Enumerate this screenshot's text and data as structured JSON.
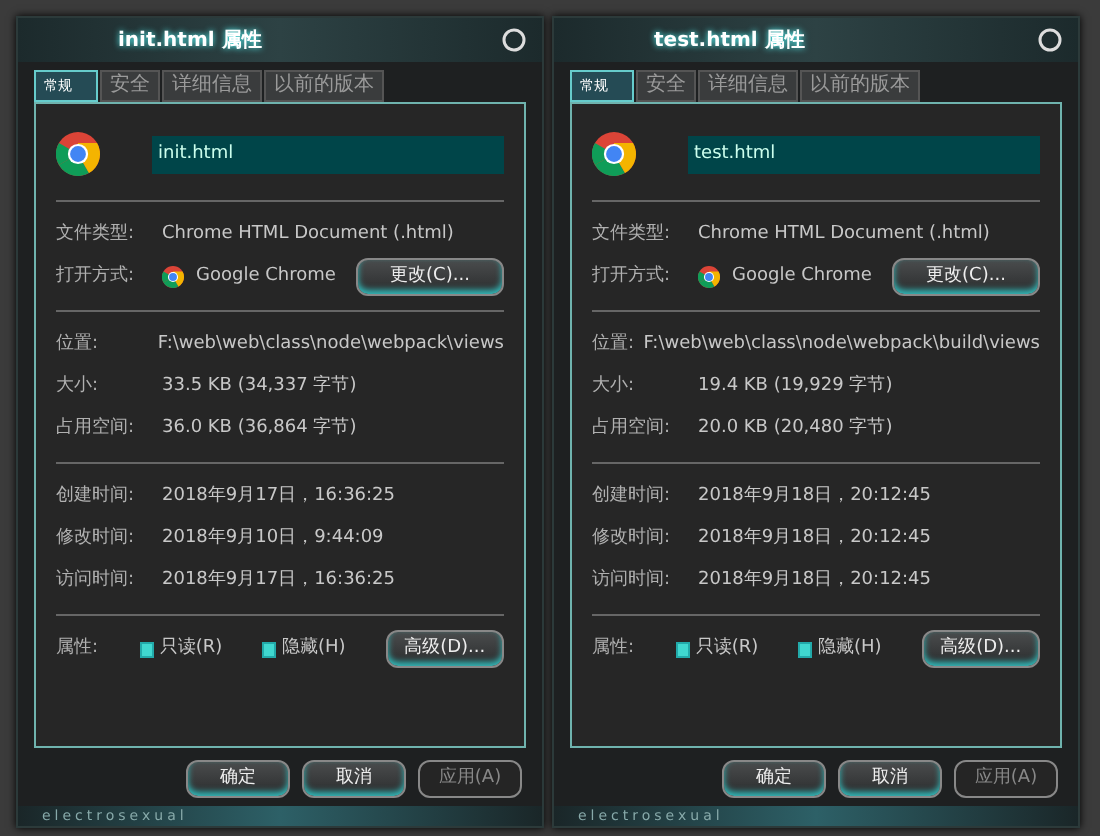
{
  "windows": [
    {
      "title": "init.html 属性",
      "tabs": [
        {
          "label": "常规",
          "selected": true
        },
        {
          "label": "安全",
          "selected": false
        },
        {
          "label": "详细信息",
          "selected": false
        },
        {
          "label": "以前的版本",
          "selected": false
        }
      ],
      "file_name": "init.html",
      "sections": [
        [
          {
            "kind": "text",
            "label": "文件类型:",
            "value": "Chrome HTML Document (.html)"
          },
          {
            "kind": "app",
            "label": "打开方式:",
            "value": "Google Chrome",
            "button": "更改(C)..."
          }
        ],
        [
          {
            "kind": "text",
            "label": "位置:",
            "value": "F:\\web\\web\\class\\node\\webpack\\views"
          },
          {
            "kind": "text",
            "label": "大小:",
            "value": "33.5 KB (34,337 字节)"
          },
          {
            "kind": "text",
            "label": "占用空间:",
            "value": "36.0 KB (36,864 字节)"
          }
        ],
        [
          {
            "kind": "text",
            "label": "创建时间:",
            "value": "2018年9月17日，16:36:25"
          },
          {
            "kind": "text",
            "label": "修改时间:",
            "value": "2018年9月10日，9:44:09"
          },
          {
            "kind": "text",
            "label": "访问时间:",
            "value": "2018年9月17日，16:36:25"
          }
        ]
      ],
      "attributes": {
        "label": "属性:",
        "checkboxes": [
          {
            "label": "只读(R)",
            "checked": true
          },
          {
            "label": "隐藏(H)",
            "checked": true
          }
        ],
        "button": "高级(D)..."
      },
      "buttons": [
        {
          "label": "确定",
          "disabled": false
        },
        {
          "label": "取消",
          "disabled": false
        },
        {
          "label": "应用(A)",
          "disabled": true
        }
      ],
      "theme_label": "electrosexual"
    },
    {
      "title": "test.html 属性",
      "tabs": [
        {
          "label": "常规",
          "selected": true
        },
        {
          "label": "安全",
          "selected": false
        },
        {
          "label": "详细信息",
          "selected": false
        },
        {
          "label": "以前的版本",
          "selected": false
        }
      ],
      "file_name": "test.html",
      "sections": [
        [
          {
            "kind": "text",
            "label": "文件类型:",
            "value": "Chrome HTML Document (.html)"
          },
          {
            "kind": "app",
            "label": "打开方式:",
            "value": "Google Chrome",
            "button": "更改(C)..."
          }
        ],
        [
          {
            "kind": "text",
            "label": "位置:",
            "value": "F:\\web\\web\\class\\node\\webpack\\build\\views"
          },
          {
            "kind": "text",
            "label": "大小:",
            "value": "19.4 KB (19,929 字节)"
          },
          {
            "kind": "text",
            "label": "占用空间:",
            "value": "20.0 KB (20,480 字节)"
          }
        ],
        [
          {
            "kind": "text",
            "label": "创建时间:",
            "value": "2018年9月18日，20:12:45"
          },
          {
            "kind": "text",
            "label": "修改时间:",
            "value": "2018年9月18日，20:12:45"
          },
          {
            "kind": "text",
            "label": "访问时间:",
            "value": "2018年9月18日，20:12:45"
          }
        ]
      ],
      "attributes": {
        "label": "属性:",
        "checkboxes": [
          {
            "label": "只读(R)",
            "checked": true
          },
          {
            "label": "隐藏(H)",
            "checked": true
          }
        ],
        "button": "高级(D)..."
      },
      "buttons": [
        {
          "label": "确定",
          "disabled": false
        },
        {
          "label": "取消",
          "disabled": false
        },
        {
          "label": "应用(A)",
          "disabled": true
        }
      ],
      "theme_label": "electrosexual"
    }
  ]
}
